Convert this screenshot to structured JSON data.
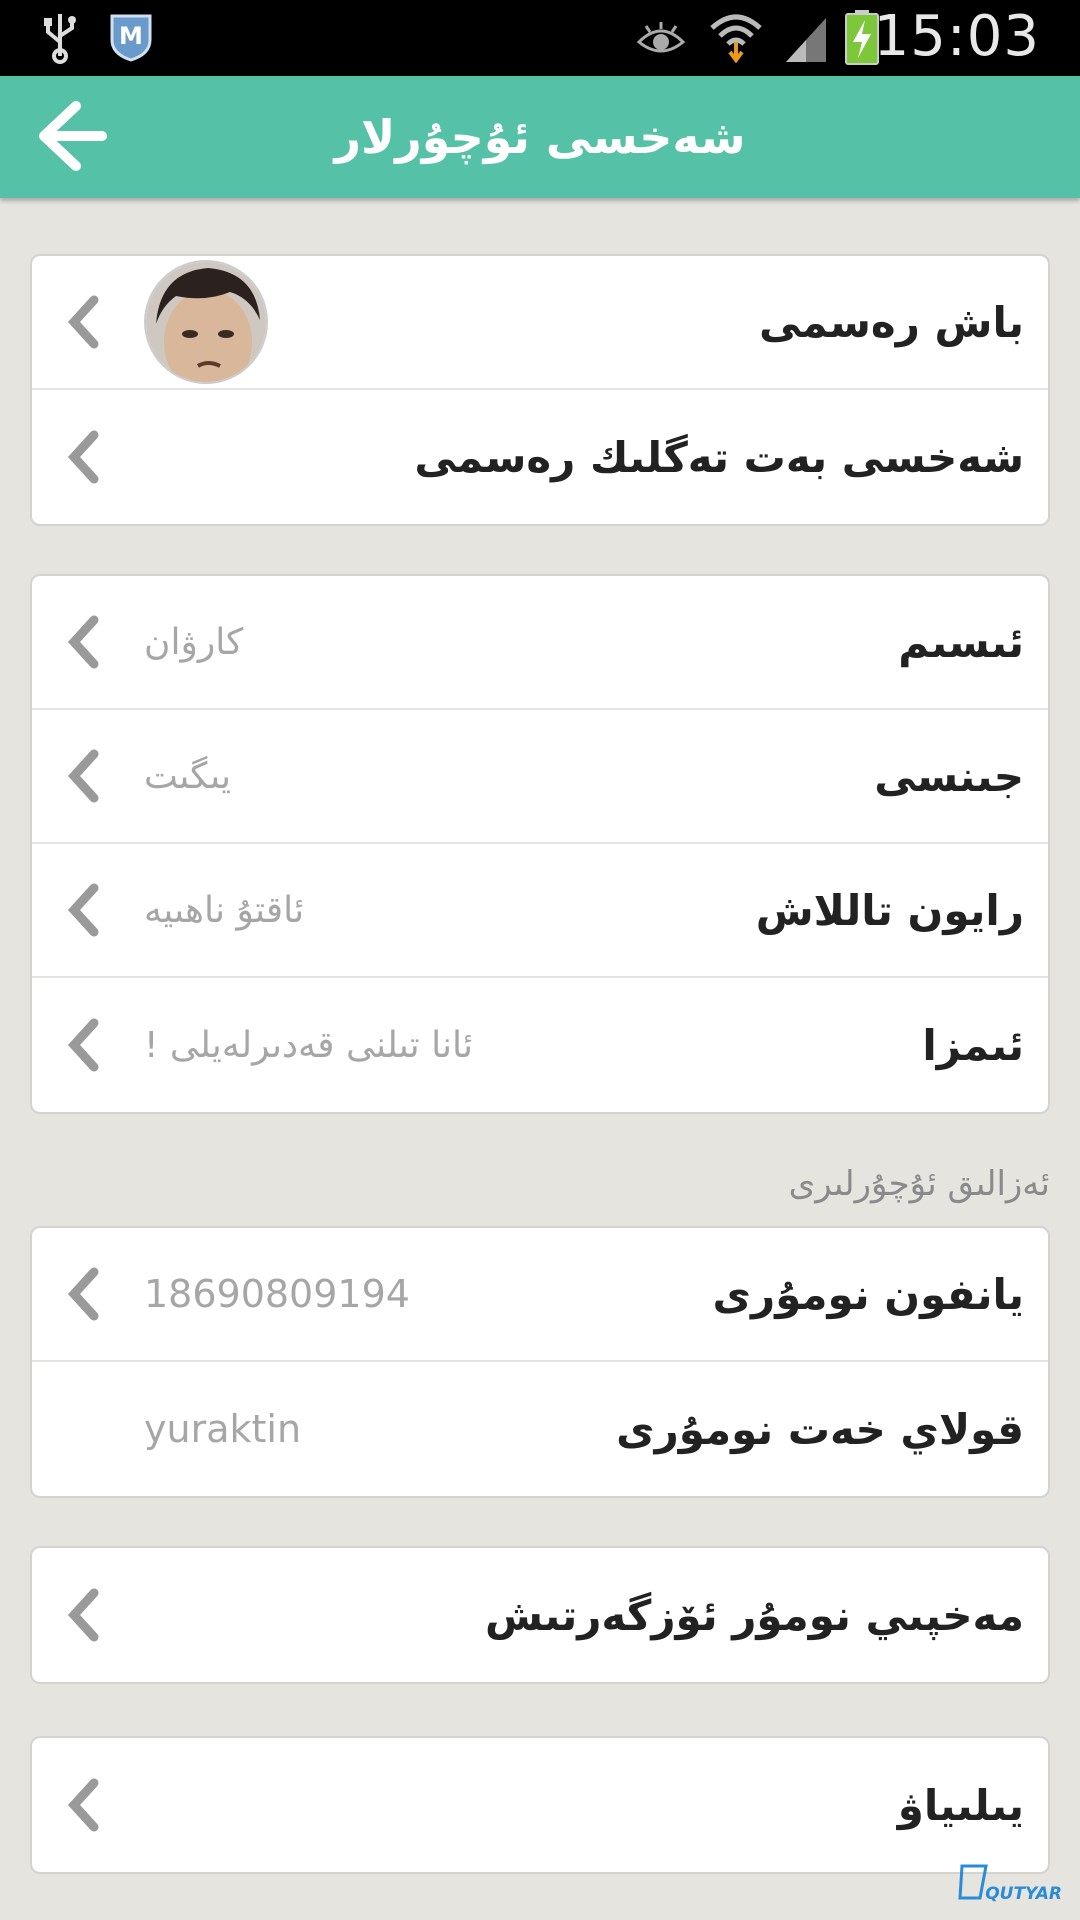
{
  "status_bar": {
    "time": "15:03",
    "icons": [
      "usb-icon",
      "security-app-icon",
      "eye-icon",
      "wifi-icon",
      "signal-icon",
      "battery-charging-icon"
    ]
  },
  "header": {
    "title": "شەخسى ئۇچۇرلار",
    "back_icon": "arrow-left-icon"
  },
  "avatar_card": {
    "rows": [
      {
        "label": "باش رەسمى",
        "value": ""
      },
      {
        "label": "شەخسى بەت تەگلىك رەسمى",
        "value": ""
      }
    ]
  },
  "profile_card": {
    "rows": [
      {
        "label": "ئىسىم",
        "value": "كارۋان"
      },
      {
        "label": "جىنسى",
        "value": "يىگىت"
      },
      {
        "label": "رايون تاللاش",
        "value": "ئاقتۇ ناھىيە"
      },
      {
        "label": "ئىمزا",
        "value": "ئانا تىلنى قەدىرلەيلى !"
      }
    ]
  },
  "contact_section_label": "ئەزالىق ئۇچۇرلىرى",
  "contact_card": {
    "rows": [
      {
        "label": "يانفون نومۇرى",
        "value": "18690809194"
      },
      {
        "label": "قولاي خەت نومۇرى",
        "value": "yuraktin"
      }
    ]
  },
  "password_card": {
    "label": "مەخپىي نومۇر ئۆزگەرتىش"
  },
  "bind_card": {
    "label": "يىلىياۋ"
  },
  "watermark": {
    "text": "QUTYAR"
  },
  "colors": {
    "header": "#55c1a7",
    "background": "#e5e4df",
    "card": "#ffffff",
    "label": "#222222",
    "value": "#a6a6a6"
  }
}
